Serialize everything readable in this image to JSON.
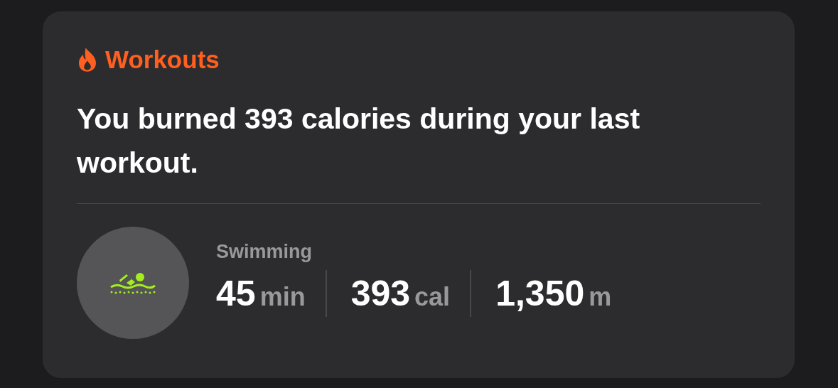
{
  "header": {
    "title": "Workouts"
  },
  "message": "You burned 393 calories during your last workout.",
  "workout": {
    "activity": "Swimming",
    "stats": [
      {
        "value": "45",
        "unit": "min"
      },
      {
        "value": "393",
        "unit": "cal"
      },
      {
        "value": "1,350",
        "unit": "m"
      }
    ]
  }
}
